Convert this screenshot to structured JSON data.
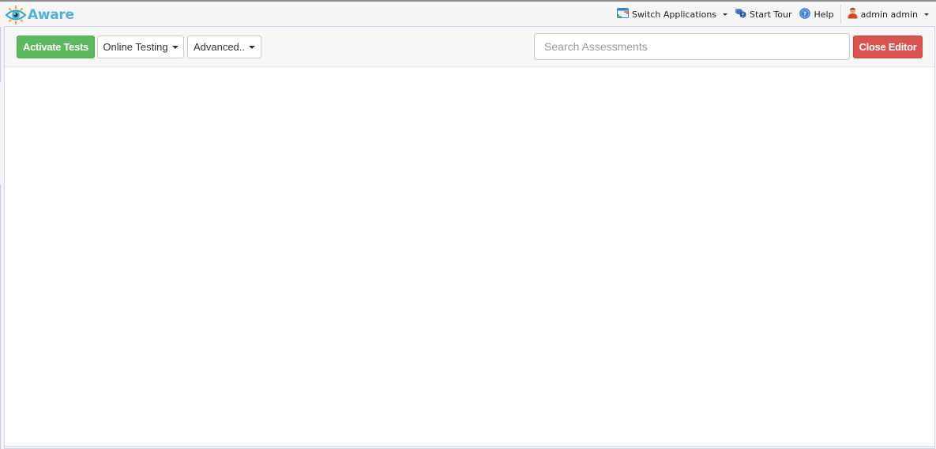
{
  "app": {
    "name": "Aware",
    "logo_icon": "eye-sun-icon"
  },
  "topnav": {
    "switch_applications": {
      "label": "Switch Applications",
      "icon": "switch-apps-icon"
    },
    "start_tour": {
      "label": "Start Tour",
      "icon": "tour-icon"
    },
    "help": {
      "label": "Help",
      "icon": "help-icon"
    },
    "user": {
      "label": "admin admin",
      "icon": "user-icon"
    }
  },
  "toolbar": {
    "activate_tests_label": "Activate Tests",
    "online_testing_label": "Online Testing",
    "advanced_label": "Advanced..",
    "search_placeholder": "Search Assessments",
    "search_value": "",
    "close_editor_label": "Close Editor"
  },
  "colors": {
    "brand": "#4fb3d1",
    "success": "#5cb85c",
    "danger": "#d9534f"
  }
}
